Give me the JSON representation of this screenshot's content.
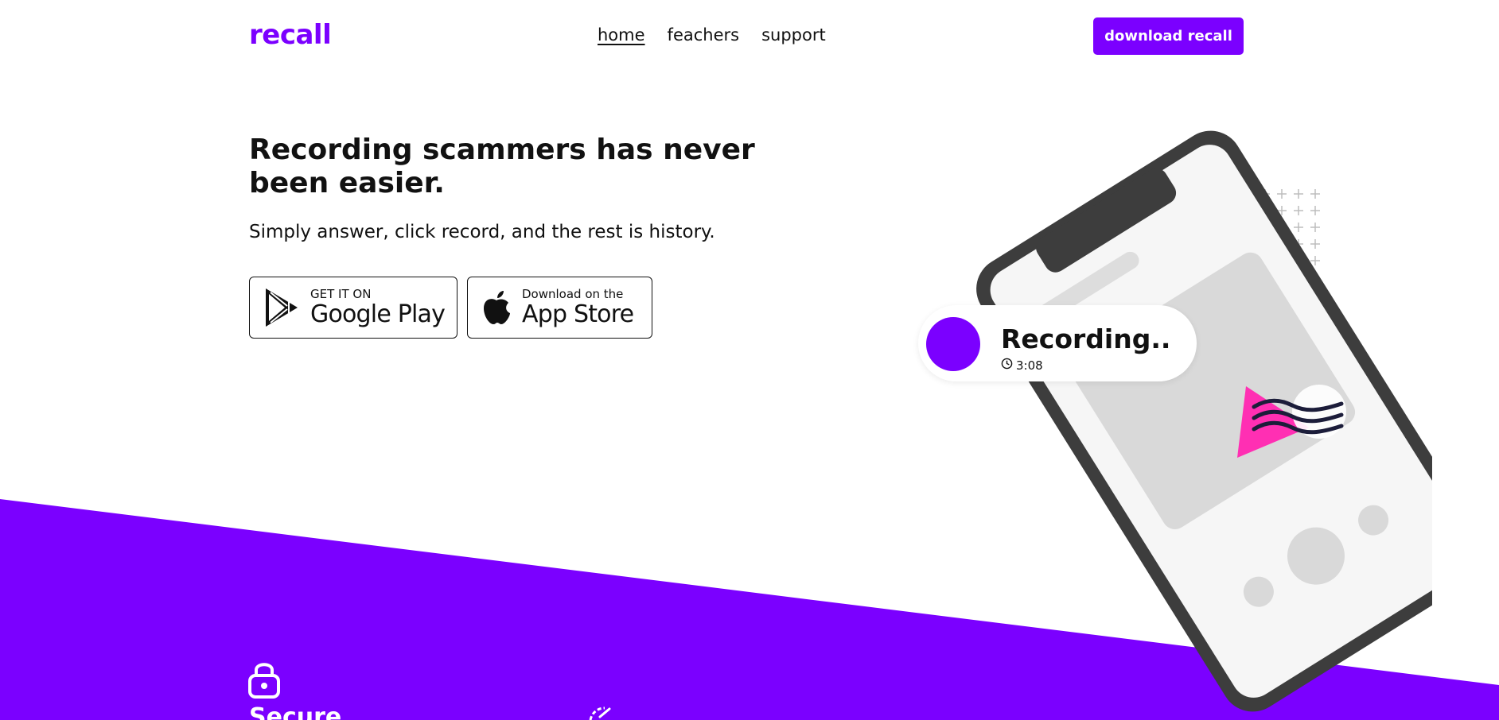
{
  "nav": {
    "logo": "recall",
    "links": [
      {
        "label": "home",
        "active": true
      },
      {
        "label": "feachers",
        "active": false
      },
      {
        "label": "support",
        "active": false
      }
    ],
    "download_label": "download recall"
  },
  "hero": {
    "title": "Recording scammers has never been easier.",
    "subtitle": "Simply answer, click record, and the rest is history."
  },
  "stores": {
    "google": {
      "small": "GET IT ON",
      "big": "Google Play"
    },
    "apple": {
      "small": "Download on the",
      "big": "App Store"
    }
  },
  "recording": {
    "title": "Recording..",
    "time": "3:08"
  },
  "features": [
    {
      "icon": "lock-icon",
      "title": "Secure"
    },
    {
      "icon": "speed-icon",
      "title": ""
    }
  ],
  "colors": {
    "brand": "#7b00ff",
    "accent_pink": "#ff2fb3",
    "phone_frame": "#3d3d3d"
  }
}
